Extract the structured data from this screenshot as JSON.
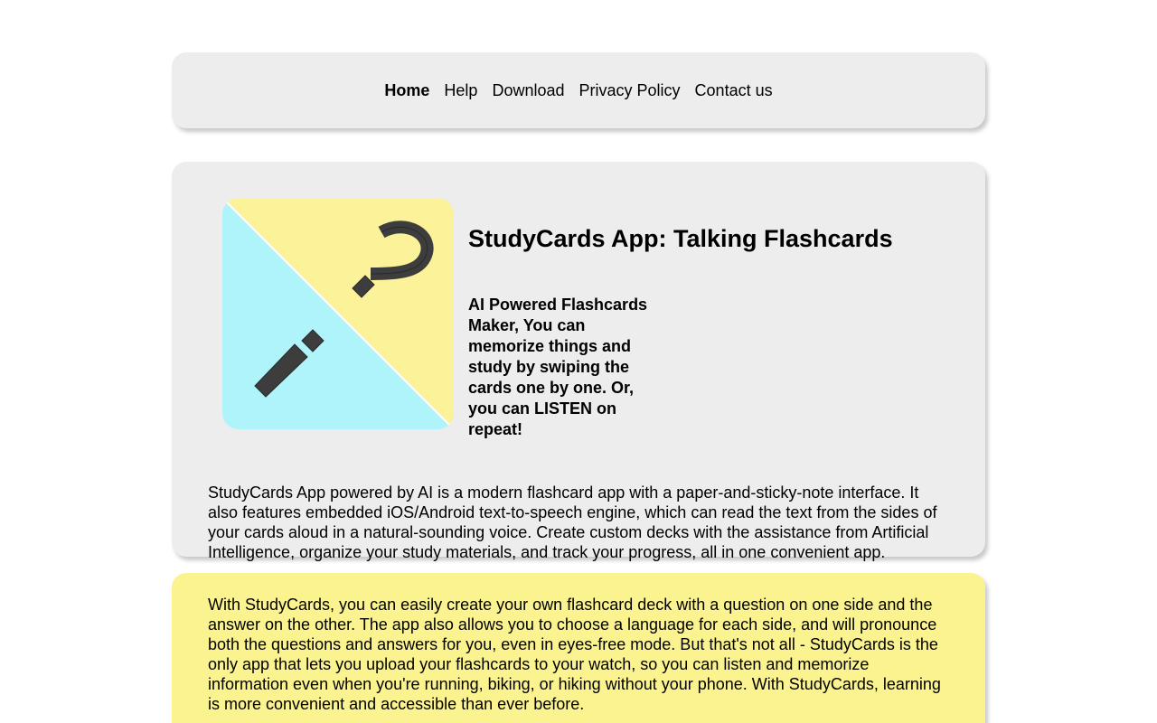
{
  "nav": {
    "items": [
      {
        "label": "Home",
        "active": true
      },
      {
        "label": "Help",
        "active": false
      },
      {
        "label": "Download",
        "active": false
      },
      {
        "label": "Privacy Policy",
        "active": false
      },
      {
        "label": "Contact us",
        "active": false
      }
    ]
  },
  "hero": {
    "icon": "question-exclamation-app-icon",
    "title": "StudyCards App: Talking Flashcards",
    "subtitle": "AI Powered Flashcards Maker, You can memorize things and study by swiping the cards one by one. Or, you can LISTEN on repeat!",
    "body": "StudyCards App powered by AI is a modern flashcard app with a paper-and-sticky-note interface. It also features embedded iOS/Android text-to-speech engine, which can read the text from the sides of your cards aloud in a natural-sounding voice. Create custom decks with the assistance from Artificial Intelligence, organize your study materials, and track your progress, all in one convenient app."
  },
  "info": {
    "body": "With StudyCards, you can easily create your own flashcard deck with a question on one side and the answer on the other. The app also allows you to choose a language for each side, and will pronounce both the questions and answers for you, even in eyes-free mode. But that's not all - StudyCards is the only app that lets you upload your flashcards to your watch, so you can listen and memorize information even when you're running, biking, or hiking without your phone. With StudyCards, learning is more convenient and accessible than ever before."
  },
  "colors": {
    "card_gray": "#ededed",
    "card_yellow": "#fbf38f",
    "icon_cyan": "#aef4fa",
    "icon_yellow": "#fbf29a",
    "icon_glyph": "#3d3d3d"
  }
}
